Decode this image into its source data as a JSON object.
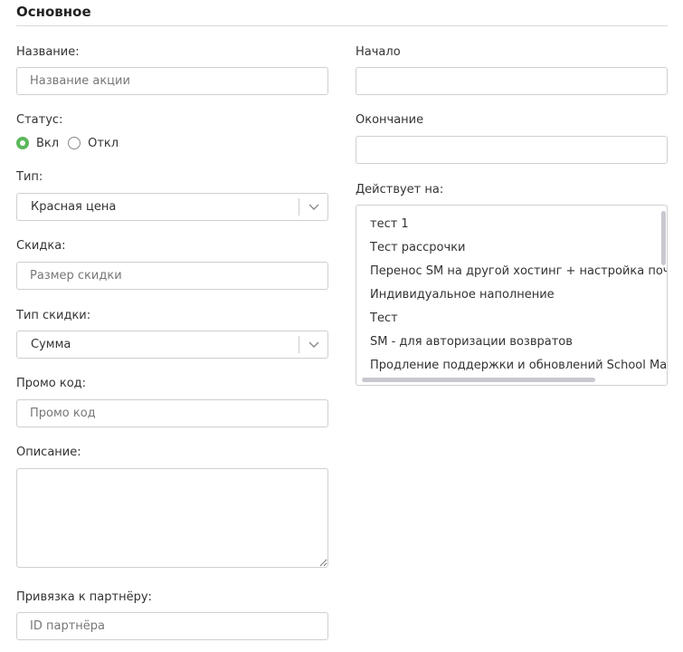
{
  "section": {
    "title": "Основное"
  },
  "form": {
    "name": {
      "label": "Название:",
      "placeholder": "Название акции"
    },
    "status": {
      "label": "Статус:",
      "options": [
        {
          "label": "Вкл",
          "selected": true
        },
        {
          "label": "Откл",
          "selected": false
        }
      ]
    },
    "type": {
      "label": "Тип:",
      "value": "Красная цена"
    },
    "discount": {
      "label": "Скидка:",
      "placeholder": "Размер скидки"
    },
    "discount_type": {
      "label": "Тип скидки:",
      "value": "Сумма"
    },
    "promo": {
      "label": "Промо код:",
      "placeholder": "Промо код"
    },
    "description": {
      "label": "Описание:"
    },
    "partner": {
      "label": "Привязка к партнёру:",
      "placeholder": "ID партнёра"
    },
    "start": {
      "label": "Начало"
    },
    "end": {
      "label": "Окончание"
    },
    "applies_to": {
      "label": "Действует на:",
      "items": [
        "тест 1",
        "Тест рассрочки",
        "Перенос SM на другой хостинг + настройка почты",
        "Индивидуальное наполнение",
        "Тест",
        "SM - для авторизации возвратов",
        "Продление поддержки и обновлений School Master"
      ]
    }
  },
  "colors": {
    "accent": "#5cb85c",
    "border": "#cfcfcf",
    "text": "#333333"
  },
  "icons": {
    "select_arrow": "chevron-down-icon"
  }
}
